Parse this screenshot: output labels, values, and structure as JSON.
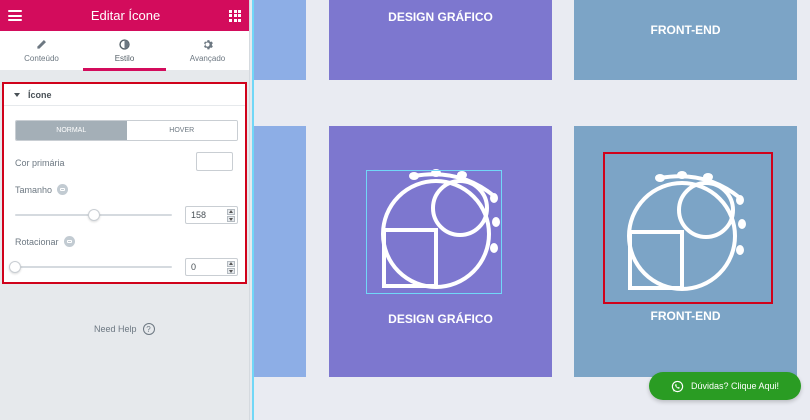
{
  "panel": {
    "title": "Editar Ícone",
    "tabs": [
      {
        "label": "Conteúdo",
        "icon": "pencil-icon"
      },
      {
        "label": "Estilo",
        "icon": "contrast-icon",
        "active": true
      },
      {
        "label": "Avançado",
        "icon": "gear-icon"
      }
    ],
    "section": {
      "title": "Ícone",
      "state_tabs": [
        "NORMAL",
        "HOVER"
      ],
      "active_state": "NORMAL",
      "primary_color_label": "Cor primária",
      "primary_color_value": "#ffffff",
      "size_label": "Tamanho",
      "size_value": "158",
      "size_slider_level": 0.5,
      "rotate_label": "Rotacionar",
      "rotate_value": "0",
      "rotate_slider_level": 0
    },
    "need_help": "Need Help"
  },
  "canvas": {
    "cards": [
      {
        "title": "DESIGN GRÁFICO",
        "color": "#7d77cf"
      },
      {
        "title": "FRONT-END",
        "color": "#7ca4c6"
      },
      {
        "title": "DESIGN GRÁFICO",
        "color": "#7d77cf"
      },
      {
        "title": "FRONT-END",
        "color": "#7ca4c6"
      }
    ]
  },
  "whatsapp": {
    "label": "Dúvidas? Clique Aqui!",
    "color": "#2a9c23"
  },
  "colors": {
    "brand": "#d30c5c",
    "selection": "#d0021b",
    "guide": "#71d7f7"
  }
}
